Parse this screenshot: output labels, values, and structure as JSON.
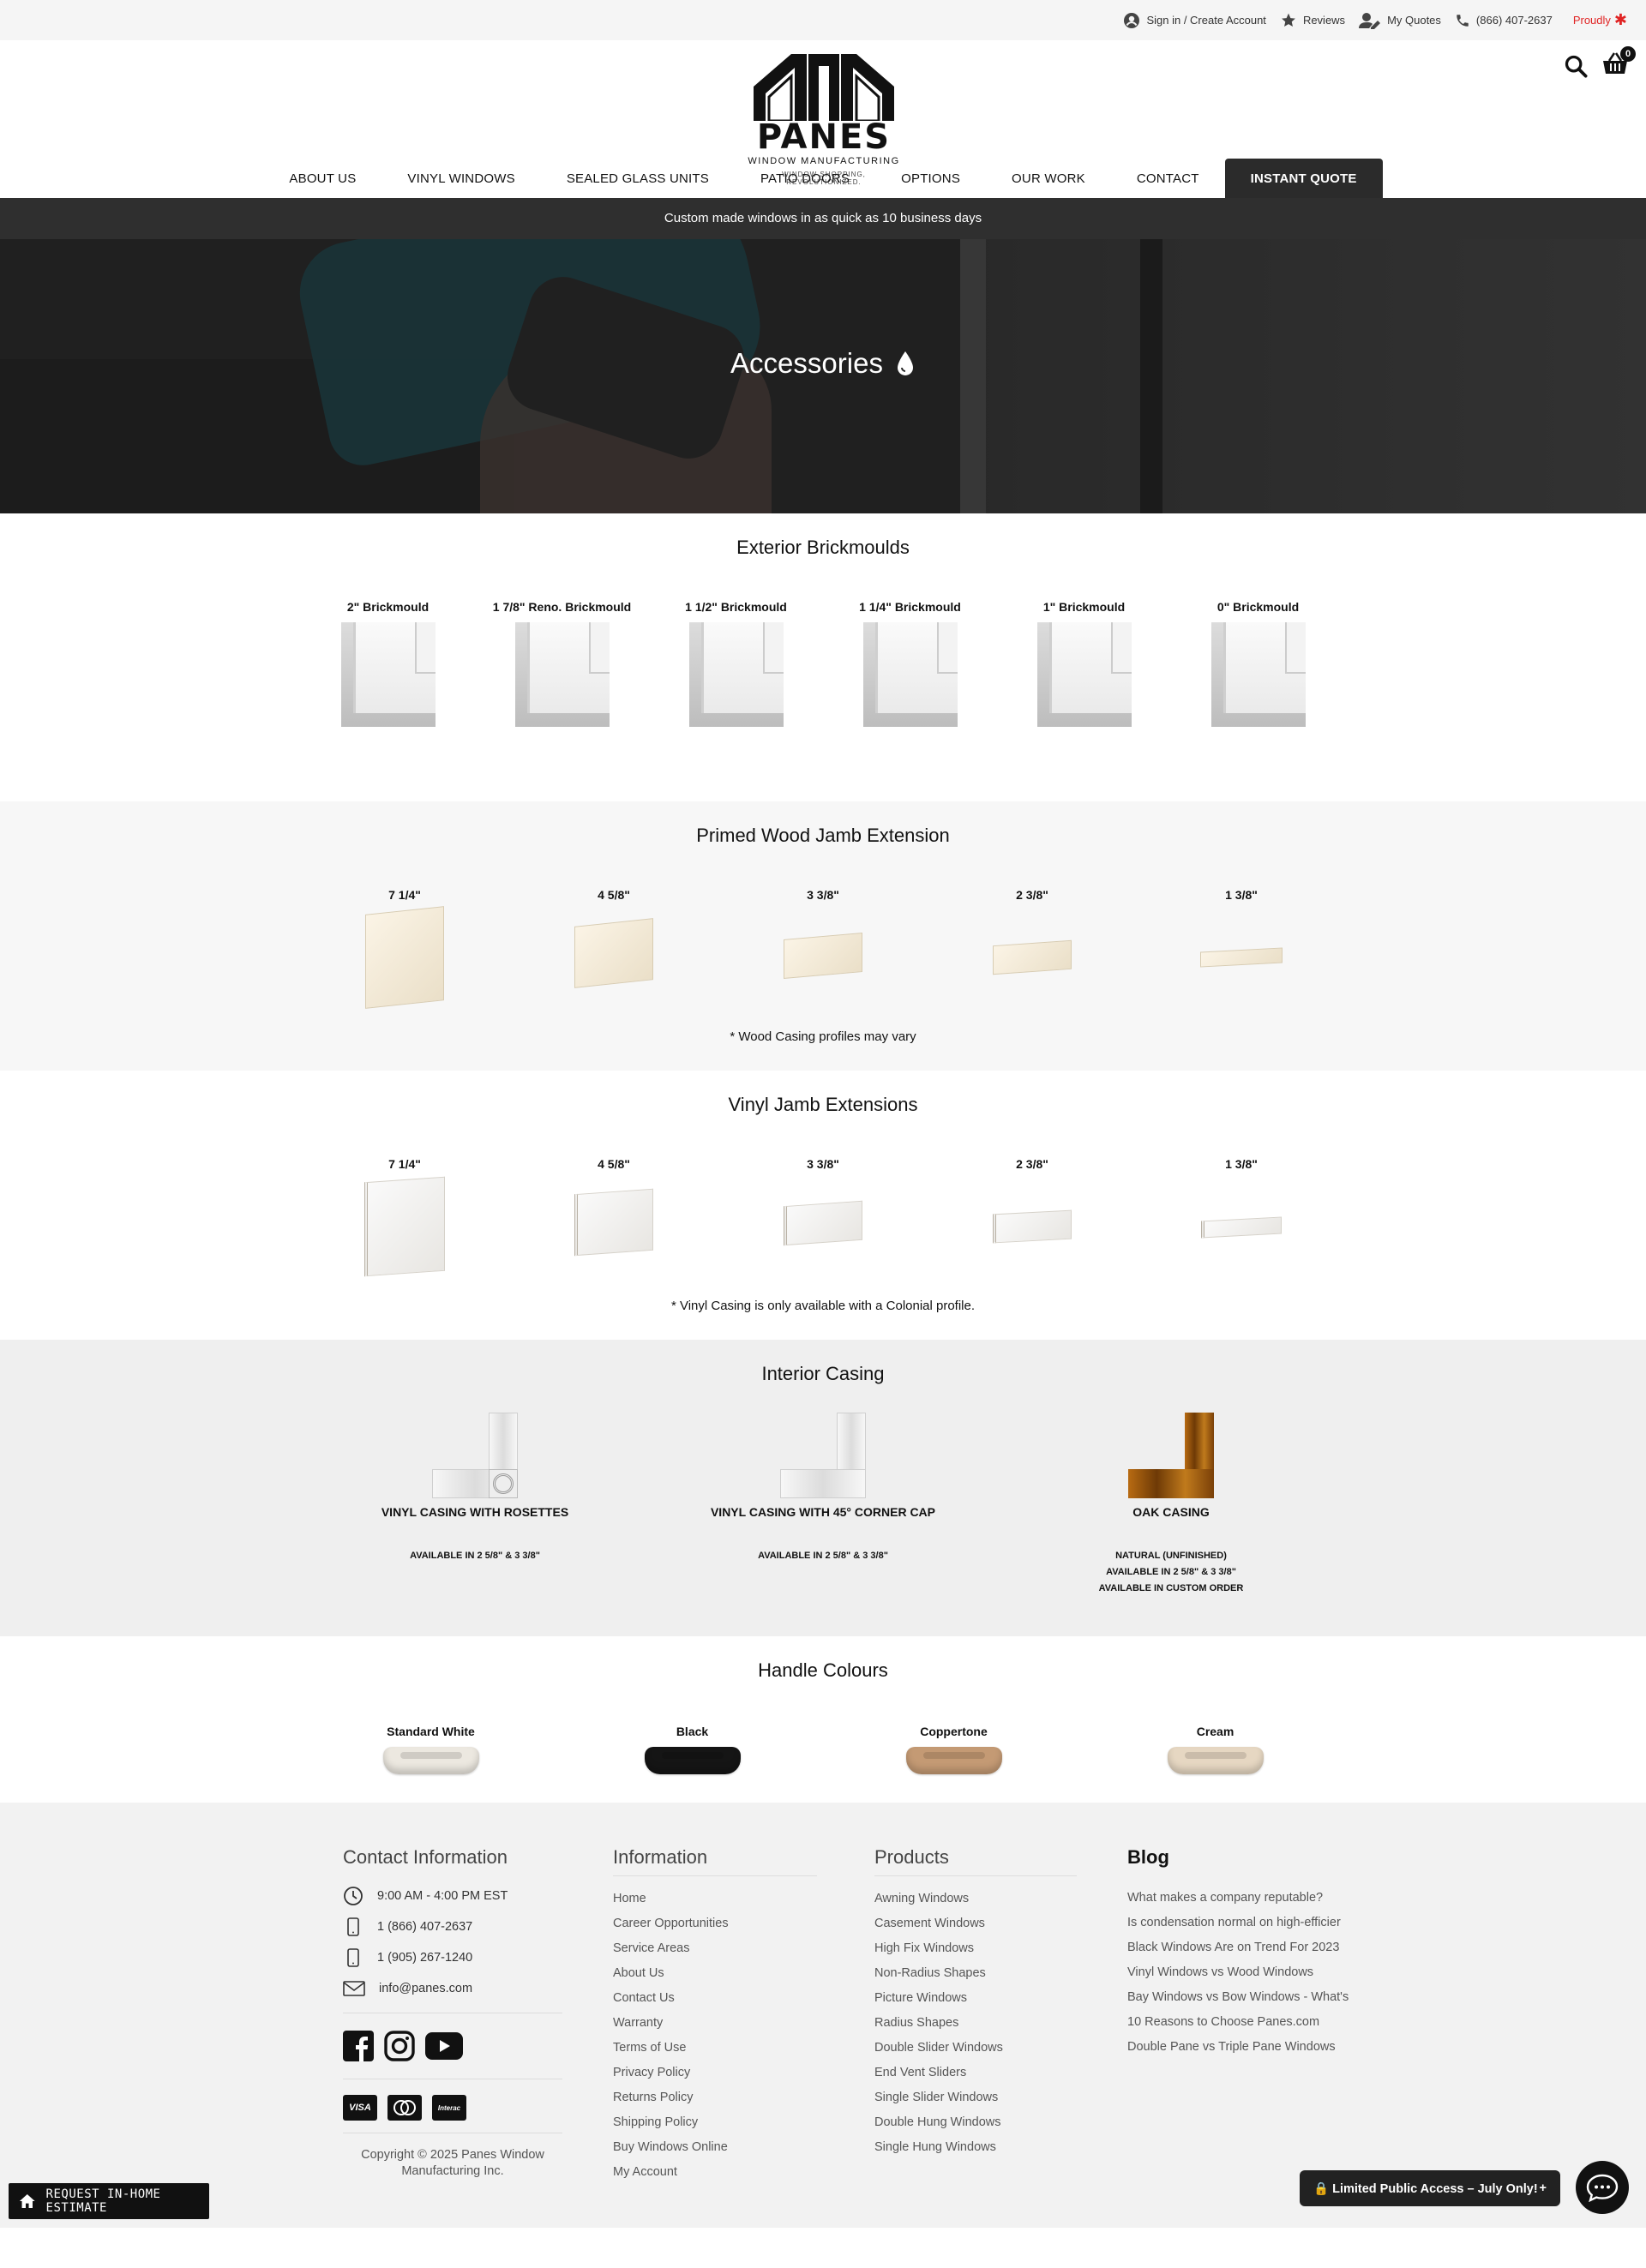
{
  "topbar": {
    "signin": "Sign in / Create Account",
    "reviews": "Reviews",
    "quotes": "My Quotes",
    "phone": "(866) 407-2637",
    "proudly": "Proudly"
  },
  "logo": {
    "brand": "PANES",
    "sub": "WINDOW MANUFACTURING",
    "tagline": "WINDOW SHOPPING, REVOLUTIONIZED."
  },
  "cart": {
    "count": "0"
  },
  "nav": [
    "ABOUT US",
    "VINYL WINDOWS",
    "SEALED GLASS UNITS",
    "PATIO DOORS",
    "OPTIONS",
    "OUR WORK",
    "CONTACT",
    "INSTANT QUOTE"
  ],
  "promo": "Custom made windows in as quick as 10 business days",
  "hero": {
    "title": "Accessories"
  },
  "brickmoulds": {
    "title": "Exterior Brickmoulds",
    "items": [
      "2\" Brickmould",
      "1 7/8\" Reno. Brickmould",
      "1 1/2\" Brickmould",
      "1 1/4\" Brickmould",
      "1\" Brickmould",
      "0\" Brickmould"
    ]
  },
  "wood_jamb": {
    "title": "Primed Wood Jamb Extension",
    "items": [
      "7 1/4\"",
      "4 5/8\"",
      "3 3/8\"",
      "2 3/8\"",
      "1 3/8\""
    ],
    "note": "* Wood Casing profiles may vary"
  },
  "vinyl_jamb": {
    "title": "Vinyl Jamb Extensions",
    "items": [
      "7 1/4\"",
      "4 5/8\"",
      "3 3/8\"",
      "2 3/8\"",
      "1 3/8\""
    ],
    "note": "* Vinyl Casing is only available with a Colonial profile."
  },
  "casing": {
    "title": "Interior Casing",
    "items": [
      {
        "name": "VINYL CASING WITH ROSETTES",
        "avail": [
          "AVAILABLE IN 2 5/8\" & 3 3/8\""
        ]
      },
      {
        "name": "VINYL CASING WITH 45° CORNER CAP",
        "avail": [
          "AVAILABLE IN 2 5/8\" & 3 3/8\""
        ]
      },
      {
        "name": "OAK CASING",
        "avail": [
          "NATURAL (UNFINISHED)",
          "AVAILABLE IN 2 5/8\" & 3 3/8\"",
          "AVAILABLE IN CUSTOM ORDER"
        ]
      }
    ]
  },
  "handles": {
    "title": "Handle Colours",
    "items": [
      {
        "name": "Standard White",
        "color": "#ece8e0"
      },
      {
        "name": "Black",
        "color": "#151515"
      },
      {
        "name": "Coppertone",
        "color": "#c49a74"
      },
      {
        "name": "Cream",
        "color": "#e6d7c2"
      }
    ]
  },
  "footer": {
    "contact": {
      "title": "Contact Information",
      "hours": "9:00 AM - 4:00 PM EST",
      "phone1": "1 (866) 407-2637",
      "phone2": "1 (905) 267-1240",
      "email": "info@panes.com"
    },
    "information": {
      "title": "Information",
      "links": [
        "Home",
        "Career Opportunities",
        "Service Areas",
        "About Us",
        "Contact Us",
        "Warranty",
        "Terms of Use",
        "Privacy Policy",
        "Returns Policy",
        "Shipping Policy",
        "Buy Windows Online",
        "My Account"
      ]
    },
    "products": {
      "title": "Products",
      "links": [
        "Awning Windows",
        "Casement Windows",
        "High Fix Windows",
        "Non-Radius Shapes",
        "Picture Windows",
        "Radius Shapes",
        "Double Slider Windows",
        "End Vent Sliders",
        "Single Slider Windows",
        "Double Hung Windows",
        "Single Hung Windows"
      ]
    },
    "blog": {
      "title": "Blog",
      "links": [
        "What makes a company reputable?",
        "Is condensation normal on high-efficier",
        "Black Windows Are on Trend For 2023",
        "Vinyl Windows vs Wood Windows",
        "Bay Windows vs Bow Windows - What's",
        "10 Reasons to Choose Panes.com",
        "Double Pane vs Triple Pane Windows"
      ]
    },
    "payments": [
      "VISA",
      "MC",
      "Interac"
    ],
    "copyright": "Copyright © 2025 Panes Window Manufacturing Inc."
  },
  "request_button": "REQUEST IN-HOME ESTIMATE",
  "limited_access": "Limited Public Access – July Only!"
}
